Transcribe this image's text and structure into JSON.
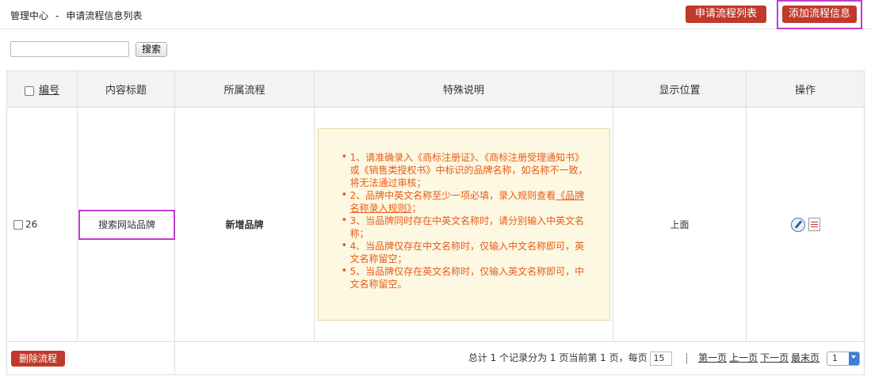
{
  "breadcrumb": {
    "home": "管理中心",
    "separator": "-",
    "current": "申请流程信息列表"
  },
  "header_buttons": {
    "list_label": "申请流程列表",
    "add_label": "添加流程信息"
  },
  "search": {
    "input_value": "",
    "button_label": "搜索"
  },
  "table": {
    "headers": {
      "id": "编号",
      "title": "内容标题",
      "flow": "所属流程",
      "note": "特殊说明",
      "position": "显示位置",
      "ops": "操作"
    },
    "rows": [
      {
        "id": "26",
        "title": "搜索网站品牌",
        "flow": "新增品牌",
        "position": "上面",
        "notes": [
          "1、请准确录入《商标注册证》、《商标注册受理通知书》或《销售类授权书》中标识的品牌名称，如名称不一致，将无法通过审核；",
          "2、品牌中英文名称至少一项必填，录入规则查看",
          "3、当品牌同时存在中英文名称时，请分别输入中英文名称；",
          "4、当品牌仅存在中文名称时，仅输入中文名称即可，英文名称留空；",
          "5、当品牌仅存在英文名称时，仅输入英文名称即可，中文名称留空。"
        ],
        "note_link": "《品牌名称录入规则》",
        "note_tail": "；"
      }
    ]
  },
  "footer": {
    "delete_label": "删除流程",
    "summary": "总计 1 个记录分为 1 页当前第 1 页，每页",
    "per_page": "15",
    "first": "第一页",
    "prev": "上一页",
    "next": "下一页",
    "last": "最末页",
    "page_select": "1"
  },
  "icons": {
    "edit": "edit-icon",
    "view": "document-icon",
    "dropdown": "chevron-down-icon"
  },
  "colors": {
    "accent_red": "#c0392b",
    "highlight": "#c13bd0",
    "notice_text": "#e85a1b",
    "notice_bg": "#fdf8e1"
  }
}
